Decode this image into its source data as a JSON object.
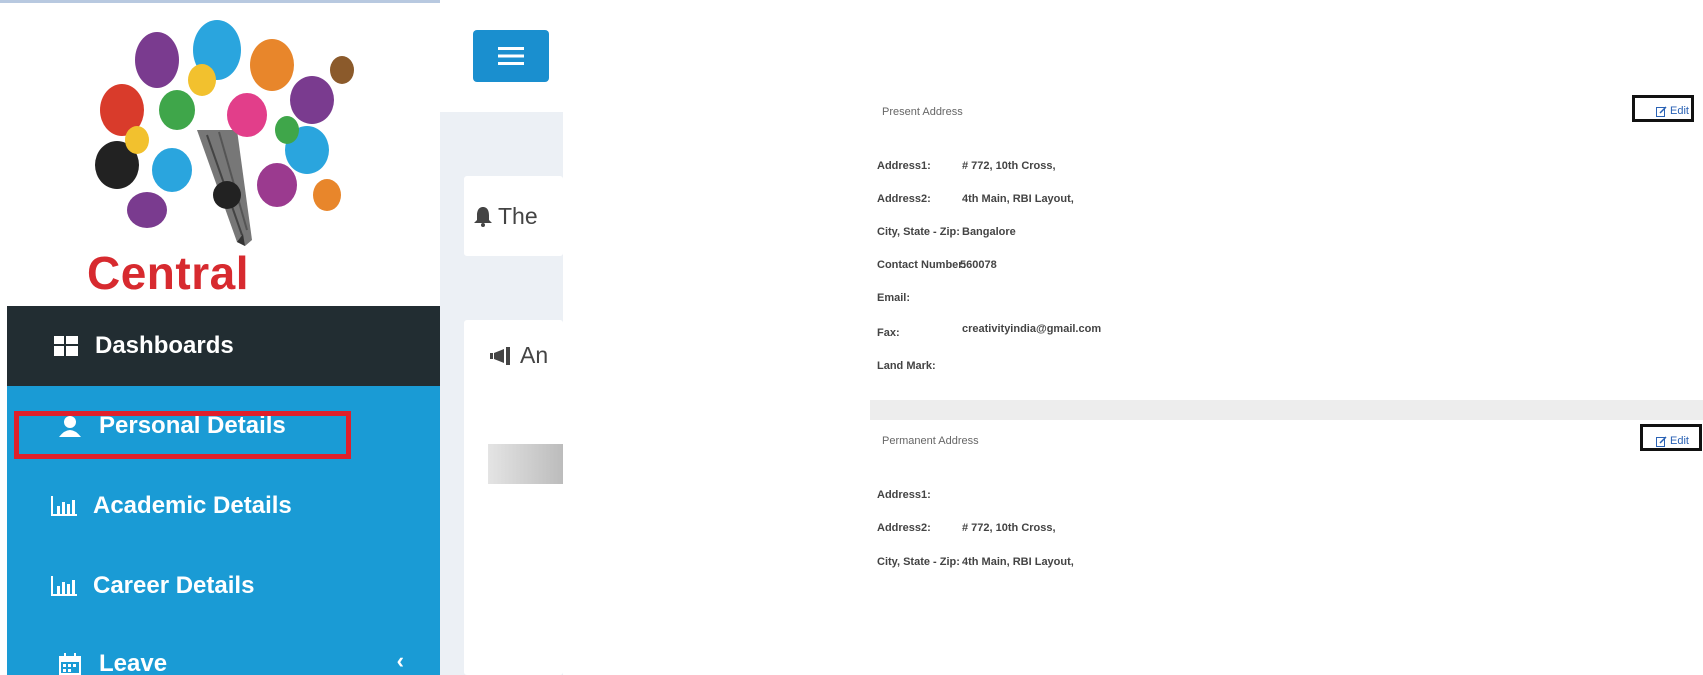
{
  "app": {
    "logo_text": "Central"
  },
  "sidebar": {
    "items": [
      {
        "label": "Dashboards",
        "icon": "dashboard-icon"
      },
      {
        "label": "Personal Details",
        "icon": "user-icon"
      },
      {
        "label": "Academic Details",
        "icon": "bar-chart-icon"
      },
      {
        "label": "Career Details",
        "icon": "bar-chart-icon"
      },
      {
        "label": "Leave",
        "icon": "calendar-icon"
      }
    ],
    "leave_chevron": "‹"
  },
  "content": {
    "notice_partial": "The",
    "announcement_partial": "An"
  },
  "present_address": {
    "title": "Present Address",
    "edit_label": "Edit",
    "fields": [
      {
        "label": "Address1:",
        "value": "# 772, 10th Cross,"
      },
      {
        "label": "Address2:",
        "value": "4th Main, RBI Layout,"
      },
      {
        "label": "City, State - Zip:",
        "value": "Bangalore"
      },
      {
        "label": "Contact Number:",
        "value": "560078"
      },
      {
        "label": "Email:",
        "value": ""
      },
      {
        "label": "Fax:",
        "value": "creativityindia@gmail.com"
      },
      {
        "label": "Land Mark:",
        "value": ""
      }
    ]
  },
  "permanent_address": {
    "title": "Permanent Address",
    "edit_label": "Edit",
    "fields": [
      {
        "label": "Address1:",
        "value": ""
      },
      {
        "label": "Address2:",
        "value": "# 772, 10th Cross,"
      },
      {
        "label": "City, State - Zip:",
        "value": "4th Main, RBI Layout,"
      }
    ]
  },
  "colors": {
    "sidebar_bg": "#1a9bd5",
    "dashboard_bg": "#222d32",
    "highlight_border": "#e01f2b",
    "logo_text": "#d72a2f",
    "edit_link": "#2a62b5"
  }
}
